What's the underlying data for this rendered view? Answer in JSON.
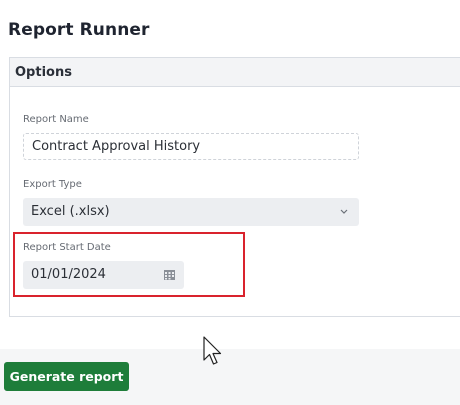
{
  "page": {
    "title": "Report Runner"
  },
  "options_panel": {
    "header": "Options",
    "report_name": {
      "label": "Report Name",
      "value": "Contract Approval History"
    },
    "export_type": {
      "label": "Export Type",
      "selected": "Excel (.xlsx)",
      "icon": "chevron-down-icon"
    },
    "report_start_date": {
      "label": "Report Start Date",
      "value": "01/01/2024",
      "icon": "calendar-icon"
    }
  },
  "actions": {
    "generate_label": "Generate report"
  },
  "colors": {
    "accent_button": "#1e7d3a",
    "highlight_border": "#d9232d",
    "panel_header_bg": "#f3f4f6",
    "input_bg": "#eceef1"
  }
}
